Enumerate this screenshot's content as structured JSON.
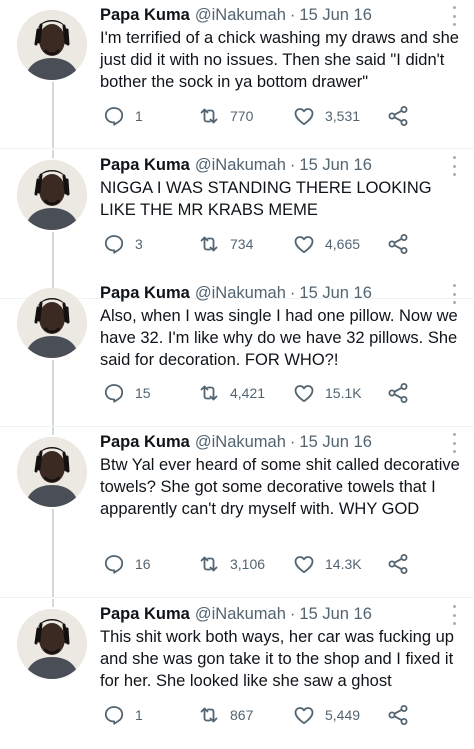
{
  "colors": {
    "text": "#0f1419",
    "secondary": "#536471",
    "thread_line": "#cfd9de",
    "divider": "#eff3f4"
  },
  "icons": {
    "reply": "reply-icon",
    "retweet": "retweet-icon",
    "like": "heart-icon",
    "share": "share-icon",
    "more": "more-icon"
  },
  "tweets": [
    {
      "name": "Papa Kuma",
      "handle": "@iNakumah",
      "separator": "·",
      "date": "15 Jun 16",
      "text": "I'm terrified of a chick washing my draws and she just did it with no issues. Then she said \"I didn't bother the sock in ya bottom drawer\"",
      "replies": "1",
      "retweets": "770",
      "likes": "3,531"
    },
    {
      "name": "Papa Kuma",
      "handle": "@iNakumah",
      "separator": "·",
      "date": "15 Jun 16",
      "text": "NIGGA I WAS STANDING THERE LOOKING LIKE THE MR KRABS MEME",
      "replies": "3",
      "retweets": "734",
      "likes": "4,665"
    },
    {
      "name": "Papa Kuma",
      "handle": "@iNakumah",
      "separator": "·",
      "date": "15 Jun 16",
      "text": "Also, when I was single I had one pillow. Now we have 32. I'm like why do we have 32 pillows. She said for decoration. FOR WHO?!",
      "replies": "15",
      "retweets": "4,421",
      "likes": "15.1K"
    },
    {
      "name": "Papa Kuma",
      "handle": "@iNakumah",
      "separator": "·",
      "date": "15 Jun 16",
      "text": "Btw Yal ever heard of some shit called decorative towels? She got some decorative towels that I apparently can't dry myself with. WHY GOD",
      "replies": "16",
      "retweets": "3,106",
      "likes": "14.3K"
    },
    {
      "name": "Papa Kuma",
      "handle": "@iNakumah",
      "separator": "·",
      "date": "15 Jun 16",
      "text": "This shit work both ways, her car was fucking up and she was gon take it to the shop and I fixed it for her. She looked like she saw a ghost",
      "replies": "1",
      "retweets": "867",
      "likes": "5,449"
    }
  ]
}
